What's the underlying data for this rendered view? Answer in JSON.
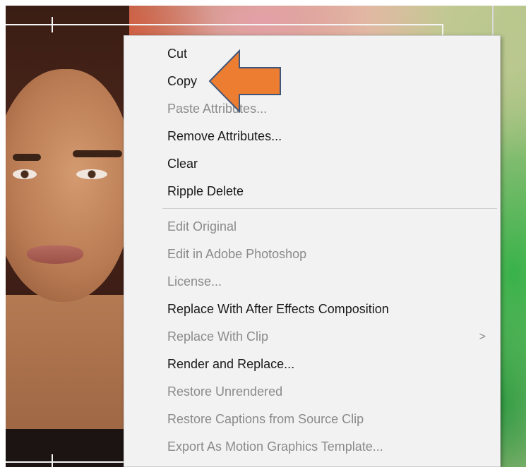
{
  "context_menu": {
    "group1": [
      {
        "label": "Cut",
        "enabled": true
      },
      {
        "label": "Copy",
        "enabled": true
      },
      {
        "label": "Paste Attributes...",
        "enabled": false
      },
      {
        "label": "Remove Attributes...",
        "enabled": true
      },
      {
        "label": "Clear",
        "enabled": true
      },
      {
        "label": "Ripple Delete",
        "enabled": true
      }
    ],
    "group2": [
      {
        "label": "Edit Original",
        "enabled": false
      },
      {
        "label": "Edit in Adobe Photoshop",
        "enabled": false
      },
      {
        "label": "License...",
        "enabled": false
      },
      {
        "label": "Replace With After Effects Composition",
        "enabled": true
      },
      {
        "label": "Replace With Clip",
        "enabled": false,
        "submenu_glyph": ">"
      },
      {
        "label": "Render and Replace...",
        "enabled": true
      },
      {
        "label": "Restore Unrendered",
        "enabled": false
      },
      {
        "label": "Restore Captions from Source Clip",
        "enabled": false
      },
      {
        "label": "Export As Motion Graphics Template...",
        "enabled": false
      }
    ]
  },
  "annotation": {
    "arrow_color": "#ed7d31",
    "arrow_outline": "#41577a",
    "points_to": "Copy"
  },
  "colors": {
    "menu_bg": "#f2f2f2",
    "text_enabled": "#1a1a1a",
    "text_disabled": "#8a8a8a"
  }
}
